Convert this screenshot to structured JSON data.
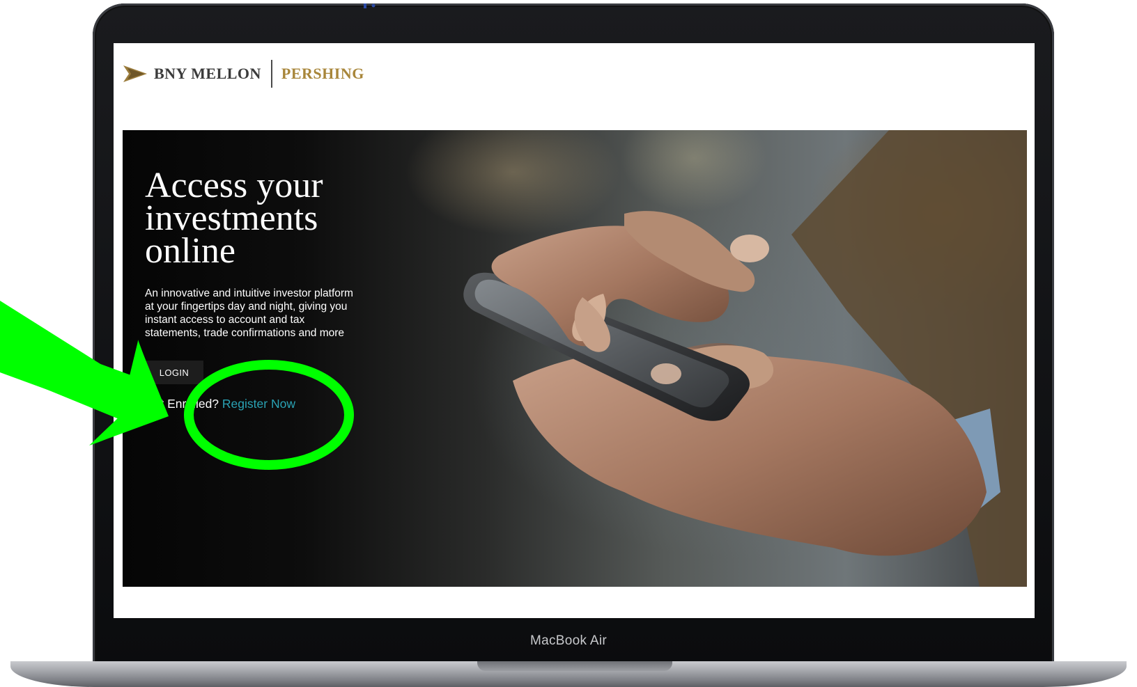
{
  "device": {
    "label": "MacBook Air"
  },
  "brand": {
    "primary": "BNY MELLON",
    "secondary": "PERSHING",
    "gold": "#a8863a"
  },
  "hero": {
    "title": "Access your investments online",
    "description": "An innovative and intuitive investor platform at your fingertips day and night, giving you instant access to account and tax statements, trade confirmations and more",
    "login_label": "LOGIN",
    "enroll_prompt": "Not Enrolled?",
    "register_label": "Register Now",
    "link_color": "#2aa3b5"
  },
  "annotation": {
    "color": "#00ff00",
    "shapes": [
      "arrow",
      "circle"
    ]
  }
}
